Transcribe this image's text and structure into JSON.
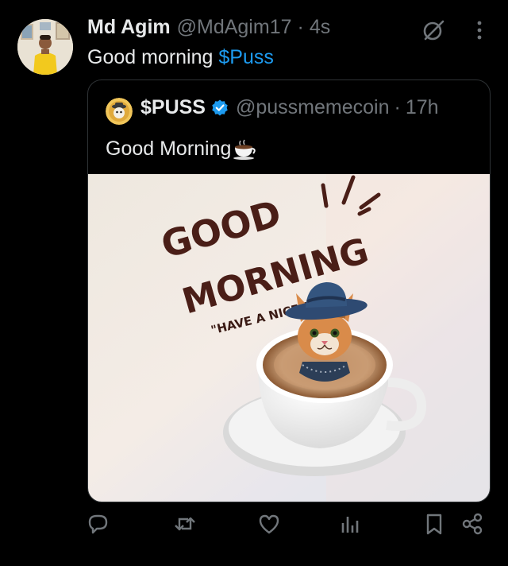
{
  "tweet": {
    "author_name": "Md Agim",
    "author_handle": "@MdAgim17",
    "separator": "·",
    "time": "4s",
    "text_plain": "Good morning ",
    "text_cashtag": "$Puss"
  },
  "quoted": {
    "author_name": "$PUSS",
    "author_handle": "@pussmemecoin",
    "separator": "·",
    "time": "17h",
    "text": "Good Morning",
    "media": {
      "line1": "GOOD",
      "line2": "MORNING",
      "line3": "\"HAVE A NICE DAY\""
    }
  },
  "icons": {
    "grok": "grok-icon",
    "more": "more-icon",
    "verified": "verified-badge-icon",
    "reply": "reply-icon",
    "retweet": "retweet-icon",
    "like": "like-icon",
    "views": "views-icon",
    "bookmark": "bookmark-icon",
    "share": "share-icon"
  },
  "colors": {
    "background": "#000000",
    "text": "#e7e9ea",
    "secondary": "#71767b",
    "accent": "#1d9bf0",
    "border": "#2f3336"
  }
}
